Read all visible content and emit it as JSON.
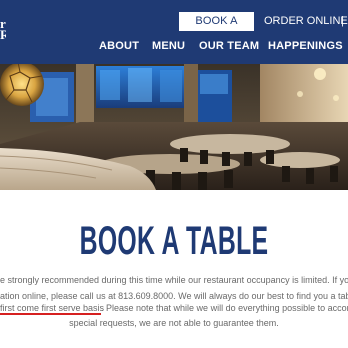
{
  "header": {
    "background": "#1f3a74",
    "book_label": "BOOK A TABLE",
    "order_label": "ORDER ONLINE",
    "separator": "|",
    "nav": [
      "ABOUT",
      "MENU",
      "OUR TEAM",
      "HAPPENINGS"
    ]
  },
  "main": {
    "title": "BOOK A TABLE",
    "title_color": "#1f3a74",
    "lines": [
      "e strongly recommended during this time while our restaurant occupancy is limited. If you",
      "ation online, please call us at 813.609.8000. We will always do our best to find you a table. W",
      "first come first serve basis",
      ". Please note that while we will do everything possible to accomm",
      "special requests, we are not able to guarantee them."
    ],
    "highlight_color": "#d62020"
  }
}
